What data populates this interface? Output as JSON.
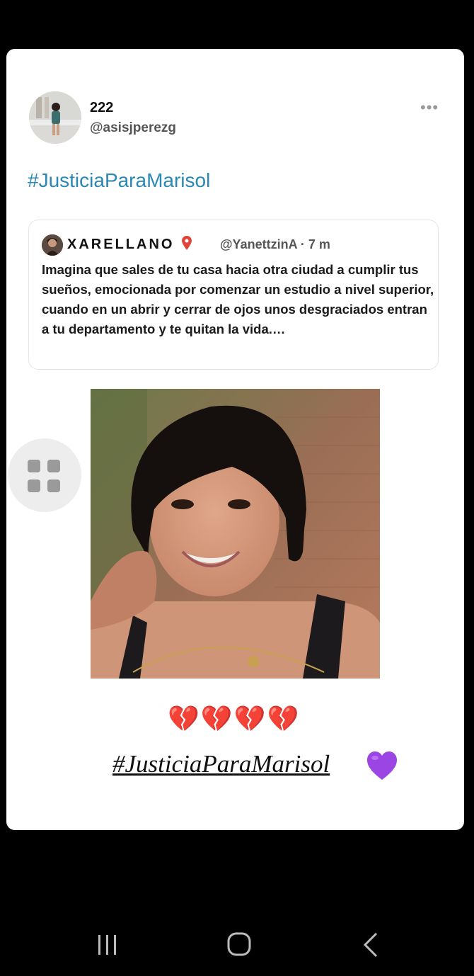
{
  "tweet": {
    "display_name": "222",
    "handle": "@asisjperezg",
    "hashtag": "#JusticiaParaMarisol",
    "more_icon": "more-horizontal-icon",
    "quote": {
      "name": "XARELLANO",
      "pin_icon": "location-pin-icon",
      "handle_time": "@YanettzinA · 7 m",
      "text": "Imagina que sales de tu casa hacia otra ciudad a cumplir tus sueños, emocionada por comenzar un estudio a nivel superior, cuando en un abrir y cerrar de ojos unos desgraciados entran a tu departamento y te quitan la vida.…"
    },
    "hearts": "💔💔💔💔",
    "hashtag_styled": "#JusticiaParaMarisol",
    "purple_heart_icon": "purple-heart-icon"
  },
  "floating_button": {
    "icon": "grid-apps-icon"
  },
  "navbar": {
    "recent_icon": "recent-apps-icon",
    "home_icon": "home-icon",
    "back_icon": "back-icon"
  },
  "colors": {
    "background": "#000000",
    "card": "#ffffff",
    "hashtag": "#2b87b6",
    "heart_broken": "#d42b2b",
    "purple_heart": "#9b45e4"
  }
}
